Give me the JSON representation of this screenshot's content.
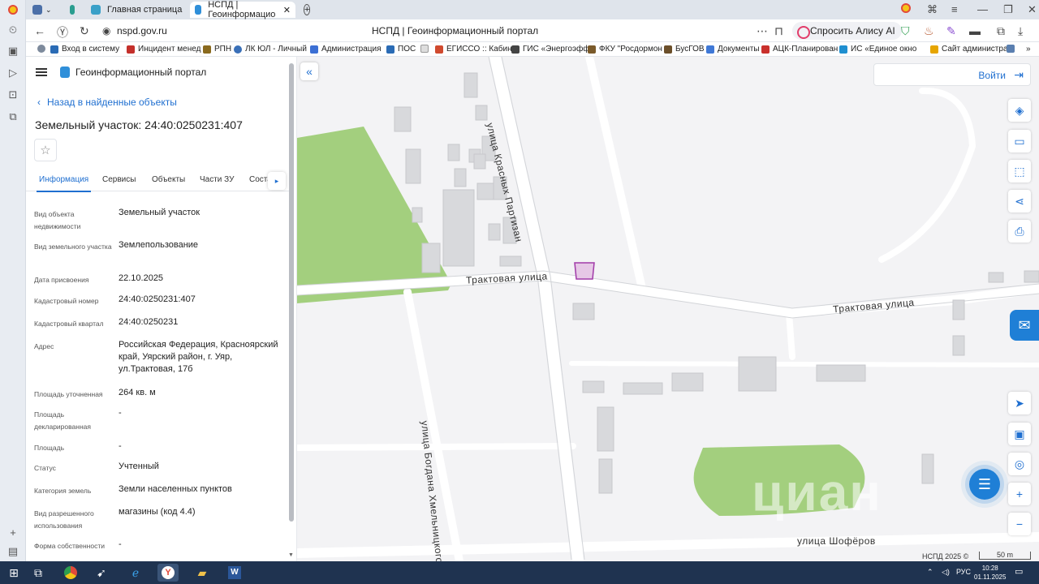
{
  "browser": {
    "tabs": [
      {
        "label": "Главная страница"
      },
      {
        "label": "НСПД | Геоинформацио"
      }
    ],
    "url": "nspd.gov.ru",
    "page_title": "НСПД | Геоинформационный портал",
    "alice_label": "Спросить Алису AI",
    "bookmarks": [
      "Вход в систему",
      "Инцидент менед",
      "РПН",
      "ЛК ЮЛ - Личный",
      "Администрация",
      "ПОС",
      "ЕГИССО :: Кабин",
      "ГИС «Энергоэфф",
      "ФКУ \"Росдормон",
      "БусГОВ",
      "Документы",
      "АЦК-Планирован",
      "ИС «Единое окно",
      "Сайт администрат"
    ]
  },
  "panel": {
    "portal_title": "Геоинформационный портал",
    "back_link": "Назад в найденные объекты",
    "object_title": "Земельный участок: 24:40:0250231:407",
    "tabs": [
      "Информация",
      "Сервисы",
      "Объекты",
      "Части ЗУ",
      "Соста"
    ],
    "fields": [
      {
        "label": "Вид объекта недвижимости",
        "value": "Земельный участок"
      },
      {
        "label": "Вид земельного участка",
        "value": "Землепользование"
      },
      {
        "label": "Дата присвоения",
        "value": "22.10.2025"
      },
      {
        "label": "Кадастровый номер",
        "value": "24:40:0250231:407"
      },
      {
        "label": "Кадастровый квартал",
        "value": "24:40:0250231"
      },
      {
        "label": "Адрес",
        "value": "Российская Федерация, Красноярский край, Уярский район, г. Уяр, ул.Трактовая, 17б"
      },
      {
        "label": "Площадь уточненная",
        "value": "264 кв. м"
      },
      {
        "label": "Площадь декларированная",
        "value": "-"
      },
      {
        "label": "Площадь",
        "value": "-"
      },
      {
        "label": "Статус",
        "value": "Учтенный"
      },
      {
        "label": "Категория земель",
        "value": "Земли населенных пунктов"
      },
      {
        "label": "Вид разрешенного использования",
        "value": "магазины (код 4.4)"
      },
      {
        "label": "Форма собственности",
        "value": "-"
      }
    ]
  },
  "map": {
    "login_label": "Войти",
    "streets": {
      "krasnyh_partizan": "улица Красных Партизан",
      "traktovaya_1": "Трактовая улица",
      "traktovaya_2": "Трактовая улица",
      "bogdana": "улица Богдана Хмельницкого",
      "shoferov": "улица Шофёров"
    },
    "copyright": "НСПД 2025 ©",
    "scale": "50 m",
    "watermark": "циан",
    "colors": {
      "parcel_fill": "#e6c8e6",
      "parcel_stroke": "#a13aa8",
      "green": "#a3cf7e",
      "building": "#d8d9dc",
      "accent": "#1f6fd0"
    }
  },
  "taskbar": {
    "lang": "РУС",
    "time": "10:28",
    "date": "01.11.2025"
  }
}
